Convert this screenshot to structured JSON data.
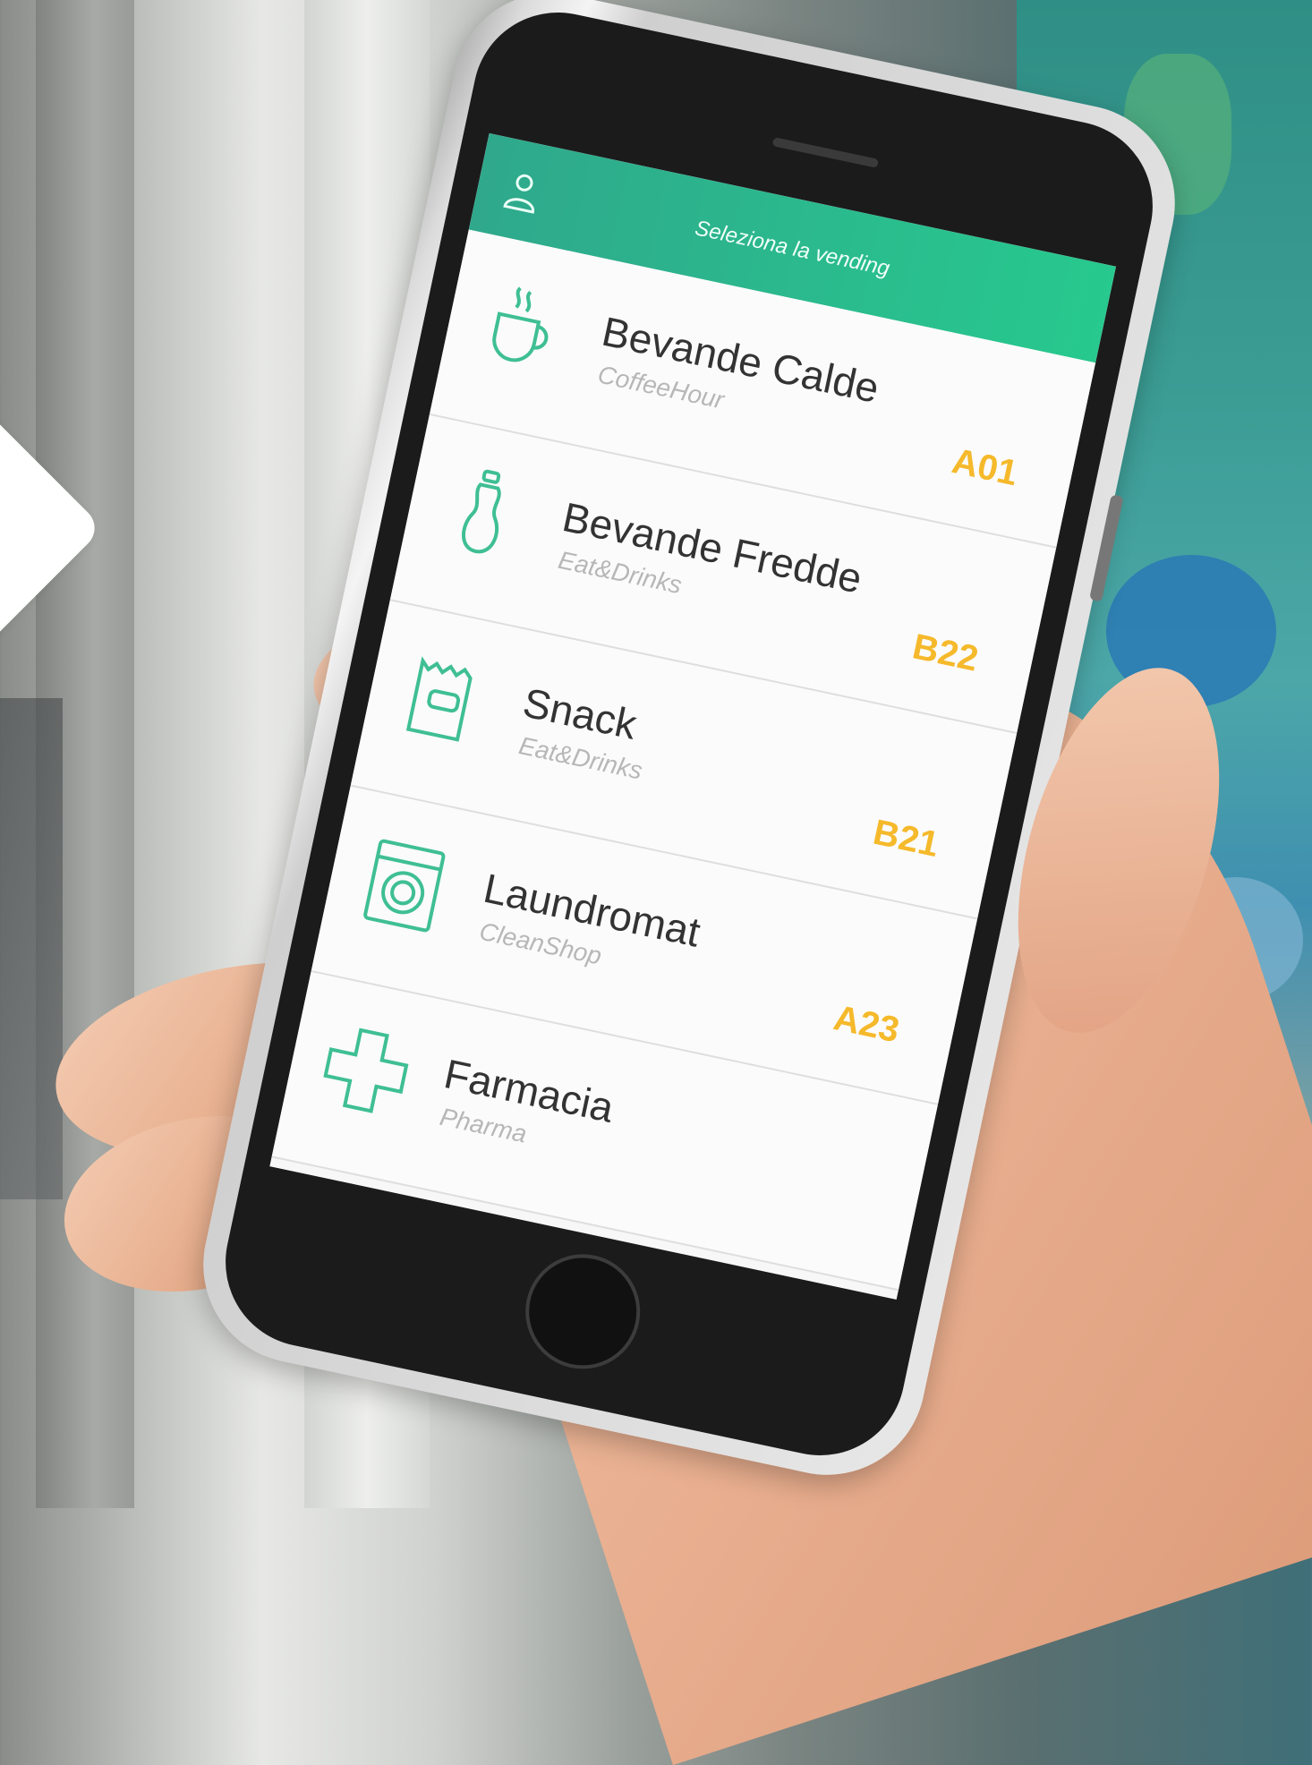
{
  "header": {
    "title": "Seleziona la vending",
    "user_icon": "user-icon"
  },
  "vendings": [
    {
      "title": "Bevande Calde",
      "subtitle": "CoffeeHour",
      "code": "A01",
      "icon": "coffee-cup-icon"
    },
    {
      "title": "Bevande Fredde",
      "subtitle": "Eat&Drinks",
      "code": "B22",
      "icon": "bottle-icon"
    },
    {
      "title": "Snack",
      "subtitle": "Eat&Drinks",
      "code": "B21",
      "icon": "snack-bag-icon"
    },
    {
      "title": "Laundromat",
      "subtitle": "CleanShop",
      "code": "A23",
      "icon": "washing-machine-icon"
    },
    {
      "title": "Farmacia",
      "subtitle": "Pharma",
      "code": "",
      "icon": "pharmacy-cross-icon"
    }
  ],
  "colors": {
    "header_gradient_start": "#2fa88c",
    "header_gradient_end": "#27c98e",
    "icon_stroke": "#3fbf93",
    "code_color": "#f5b92b"
  }
}
